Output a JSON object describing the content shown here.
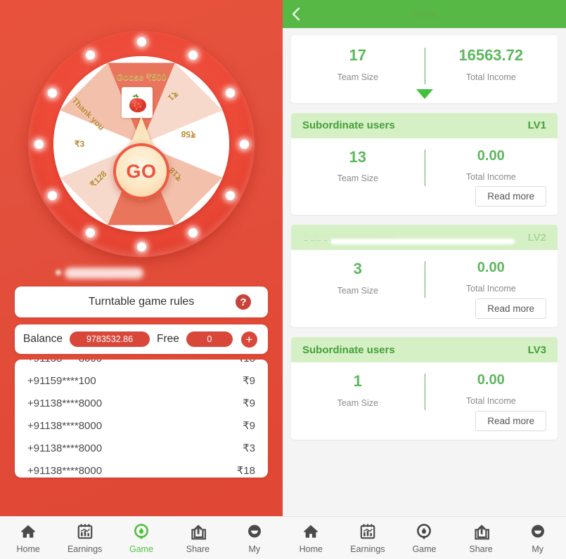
{
  "left_panel": {
    "name": "turntable-game",
    "wheel": {
      "prize_banner": "Goose ₹500",
      "prize_image_icon": "strawberry-image",
      "center_button": "GO",
      "segments": [
        {
          "label": "Goose ₹500",
          "kind": "jackpot"
        },
        {
          "label": "₹1",
          "kind": "cash"
        },
        {
          "label": "₹58",
          "kind": "cash"
        },
        {
          "label": "₹18",
          "kind": "cash"
        },
        {
          "label": "₹9",
          "kind": "cash"
        },
        {
          "label": "₹128",
          "kind": "cash"
        },
        {
          "label": "₹3",
          "kind": "cash"
        },
        {
          "label": "Thank you",
          "kind": "none"
        }
      ]
    },
    "rules": {
      "label": "Turntable game rules",
      "help_icon": "question-mark-icon",
      "help_glyph": "?"
    },
    "balance_bar": {
      "balance_label": "Balance",
      "balance_value": "9783532.86",
      "free_label": "Free",
      "free_value": "0",
      "add_icon": "plus-icon",
      "add_glyph": "+"
    },
    "winners": [
      {
        "phone": "+91159****100",
        "amount": "₹9"
      },
      {
        "phone": "+91138****8000",
        "amount": "₹9"
      },
      {
        "phone": "+91138****8000",
        "amount": "₹9"
      },
      {
        "phone": "+91138****8000",
        "amount": "₹3"
      },
      {
        "phone": "+91138****8000",
        "amount": "₹18"
      }
    ]
  },
  "right_panel": {
    "name": "team-overview",
    "header": {
      "back_icon": "back-chevron-icon",
      "title": "Team"
    },
    "summary": {
      "team_size_value": "17",
      "team_size_label": "Team Size",
      "total_income_value": "16563.72",
      "total_income_label": "Total Income",
      "expand_icon": "caret-down-icon"
    },
    "levels": [
      {
        "title": "Subordinate users",
        "badge": "LV1",
        "team_size_value": "13",
        "team_size_label": "Team Size",
        "total_income_value": "0.00",
        "total_income_label": "Total Income",
        "read_more": "Read more",
        "obscured": false
      },
      {
        "title": "Subordinate users",
        "badge": "LV2",
        "team_size_value": "3",
        "team_size_label": "Team Size",
        "total_income_value": "0.00",
        "total_income_label": "Total Income",
        "read_more": "Read more",
        "obscured": true
      },
      {
        "title": "Subordinate users",
        "badge": "LV3",
        "team_size_value": "1",
        "team_size_label": "Team Size",
        "total_income_value": "0.00",
        "total_income_label": "Total Income",
        "read_more": "Read more",
        "obscured": false
      }
    ]
  },
  "bottom_nav_left": {
    "active_index": 2,
    "items": [
      {
        "label": "Home",
        "icon": "home-icon"
      },
      {
        "label": "Earnings",
        "icon": "chart-calendar-icon"
      },
      {
        "label": "Game",
        "icon": "game-circle-icon"
      },
      {
        "label": "Share",
        "icon": "share-icon"
      },
      {
        "label": "My",
        "icon": "user-circle-icon"
      }
    ]
  },
  "bottom_nav_right": {
    "active_index": -1,
    "items": [
      {
        "label": "Home",
        "icon": "home-icon"
      },
      {
        "label": "Earnings",
        "icon": "chart-calendar-icon"
      },
      {
        "label": "Game",
        "icon": "game-circle-icon"
      },
      {
        "label": "Share",
        "icon": "share-icon"
      },
      {
        "label": "My",
        "icon": "user-circle-icon"
      }
    ]
  },
  "colors": {
    "red_bg": "#e2513d",
    "red_accent": "#d9473b",
    "green_header": "#58b846",
    "green_text": "#5cb85c",
    "green_light": "#d6f0c6",
    "gold_text": "#b98b33"
  }
}
